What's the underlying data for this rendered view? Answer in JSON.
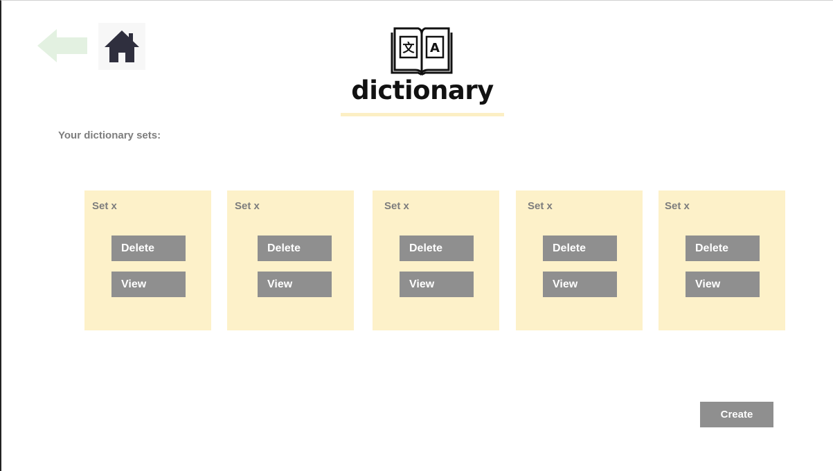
{
  "header": {
    "back_icon": "left-arrow-icon",
    "home_icon": "home-icon",
    "logo_icon": "translation-book-icon",
    "logo_glyph_left": "文",
    "logo_glyph_right": "A",
    "logo_text": "dictionary"
  },
  "sets_heading": "Your dictionary sets:",
  "sets": [
    {
      "title": "Set x",
      "delete_label": "Delete",
      "view_label": "View"
    },
    {
      "title": "Set x",
      "delete_label": "Delete",
      "view_label": "View"
    },
    {
      "title": "Set x",
      "delete_label": "Delete",
      "view_label": "View"
    },
    {
      "title": "Set x",
      "delete_label": "Delete",
      "view_label": "View"
    },
    {
      "title": "Set x",
      "delete_label": "Delete",
      "view_label": "View"
    }
  ],
  "create_label": "Create",
  "colors": {
    "card_background": "#fdf1c9",
    "button_background": "#8f8f8f",
    "back_arrow": "#e3f1e1",
    "home_icon": "#2f2f3e",
    "label_text": "#7d7d7d"
  }
}
